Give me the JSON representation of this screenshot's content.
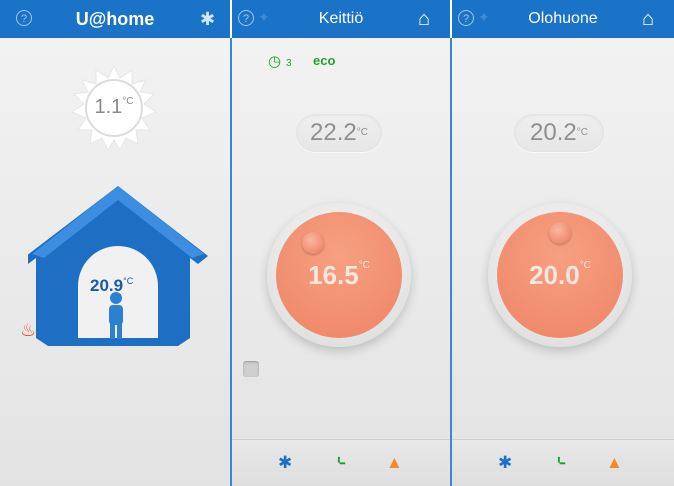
{
  "header": {
    "app_title": "U@home",
    "room1_title": "Keittiö",
    "room2_title": "Olohuone"
  },
  "icons": {
    "help": "help-icon",
    "settings": "gear-icon",
    "favorite": "star-icon",
    "home": "home-icon",
    "heating": "flame-icon",
    "schedule": "clock-icon",
    "chart": "chart-icon",
    "list": "list-icon"
  },
  "outdoor": {
    "temperature": "1.1",
    "unit": "°C"
  },
  "home": {
    "temperature": "20.9",
    "unit": "°C"
  },
  "rooms": [
    {
      "name": "Keittiö",
      "schedule_count": "3",
      "mode": "eco",
      "measured": "22.2",
      "setpoint": "16.5",
      "unit": "°C",
      "dial_level": 0.15
    },
    {
      "name": "Olohuone",
      "measured": "20.2",
      "setpoint": "20.0",
      "unit": "°C",
      "dial_level": 0.5
    }
  ],
  "colors": {
    "header": "#1a73c6",
    "dial": "#ef8a6a",
    "eco": "#24a12e",
    "flame": "#e2502e"
  }
}
